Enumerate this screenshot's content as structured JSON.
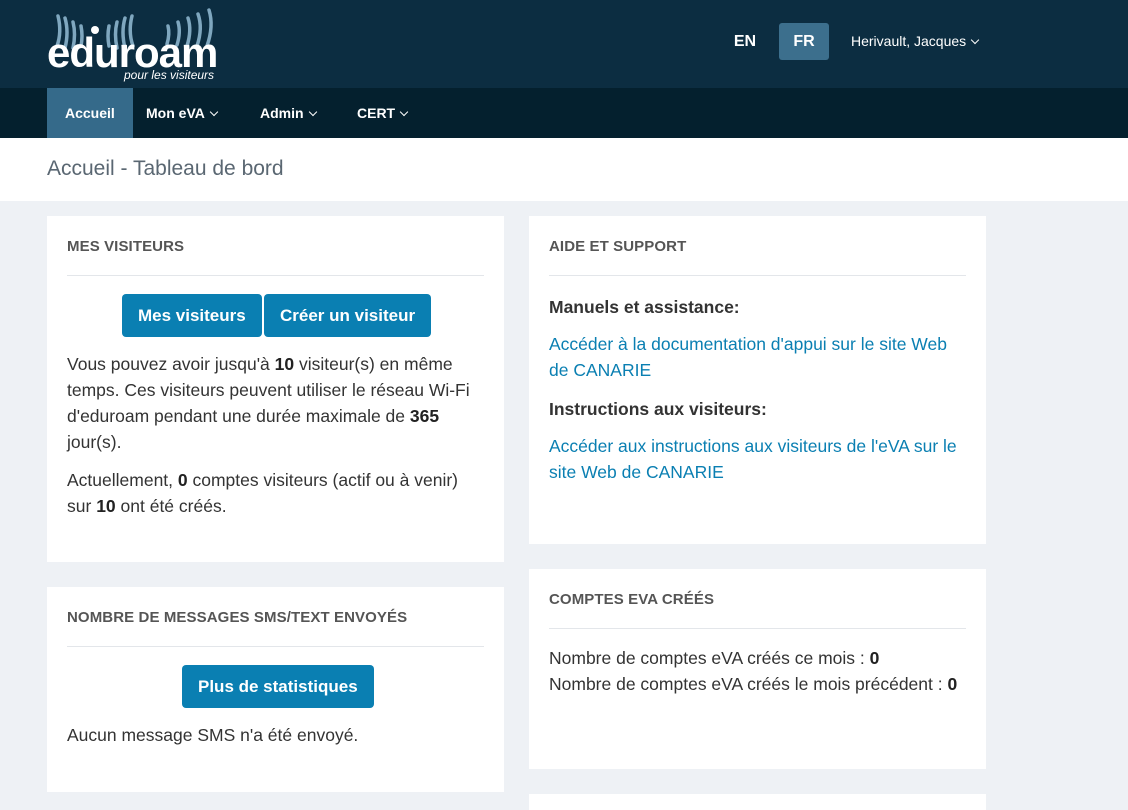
{
  "header": {
    "logo_word": "eduroam",
    "logo_tagline": "pour les visiteurs",
    "lang_en": "EN",
    "lang_fr": "FR",
    "user_name": "Herivault, Jacques"
  },
  "nav": {
    "items": [
      {
        "label": "Accueil"
      },
      {
        "label": "Mon eVA"
      },
      {
        "label": "Admin"
      },
      {
        "label": "CERT"
      }
    ]
  },
  "page_title": "Accueil - Tableau de bord",
  "visitors": {
    "title": "Mes visiteurs",
    "btn_my_visitors": "Mes visiteurs",
    "btn_create": "Créer un visiteur",
    "p1_a": "Vous pouvez avoir jusqu'à ",
    "max_visitors": "10",
    "p1_b": " visiteur(s) en même temps. Ces visiteurs peuvent utiliser le réseau Wi-Fi d'eduroam pendant une durée maximale de ",
    "max_days": "365",
    "p1_c": " jour(s).",
    "p2_a": "Actuellement, ",
    "current_accounts": "0",
    "p2_b": " comptes visiteurs (actif ou à venir) sur ",
    "total_accounts": "10",
    "p2_c": " ont été créés."
  },
  "sms": {
    "title": "Nombre de messages SMS/Text envoyés",
    "btn_stats": "Plus de statistiques",
    "text": "Aucun message SMS n'a été envoyé."
  },
  "support": {
    "title": "Aide et support",
    "manuals_heading": "Manuels et assistance:",
    "manuals_link": "Accéder à la documentation d'appui sur le site Web de CANARIE",
    "instructions_heading": "Instructions aux visiteurs:",
    "instructions_link": "Accéder aux instructions aux visiteurs de l'eVA sur le site Web de CANARIE"
  },
  "eva": {
    "title": "Comptes eVA créés",
    "this_month_label": "Nombre de comptes eVA créés ce mois : ",
    "this_month_value": "0",
    "last_month_label": "Nombre de comptes eVA créés le mois précédent : ",
    "last_month_value": "0"
  },
  "colors": {
    "header_bg": "#0c2d41",
    "nav_bg": "#04202e",
    "nav_active": "#356a8a",
    "primary": "#0a7fb2"
  }
}
